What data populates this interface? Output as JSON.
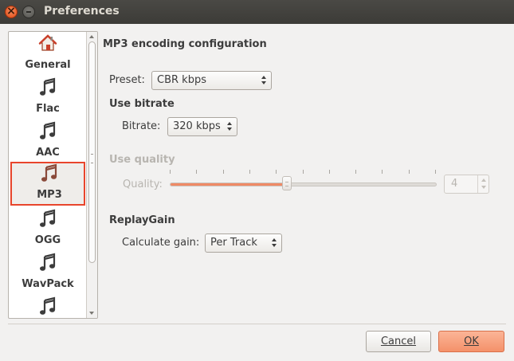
{
  "window": {
    "title": "Preferences"
  },
  "sidebar": {
    "items": [
      {
        "label": "General",
        "icon": "home-icon"
      },
      {
        "label": "Flac",
        "icon": "music-note-icon"
      },
      {
        "label": "AAC",
        "icon": "music-note-icon"
      },
      {
        "label": "MP3",
        "icon": "music-note-icon",
        "selected": true
      },
      {
        "label": "OGG",
        "icon": "music-note-icon"
      },
      {
        "label": "WavPack",
        "icon": "music-note-icon"
      },
      {
        "label": "",
        "icon": "music-note-icon"
      }
    ]
  },
  "main": {
    "heading": "MP3 encoding configuration",
    "preset": {
      "label": "Preset:",
      "value": "CBR kbps"
    },
    "use_bitrate": {
      "title": "Use bitrate",
      "label": "Bitrate:",
      "value": "320 kbps"
    },
    "use_quality": {
      "title": "Use quality",
      "label": "Quality:",
      "value": "4",
      "slider_fraction": 0.44,
      "tick_count": 10,
      "enabled": false
    },
    "replaygain": {
      "title": "ReplayGain",
      "label": "Calculate gain:",
      "value": "Per Track"
    }
  },
  "buttons": {
    "cancel": "Cancel",
    "ok": "OK"
  },
  "colors": {
    "accent": "#ef8a65",
    "selection_border": "#e8452c",
    "ok_button": "#f4916a"
  }
}
